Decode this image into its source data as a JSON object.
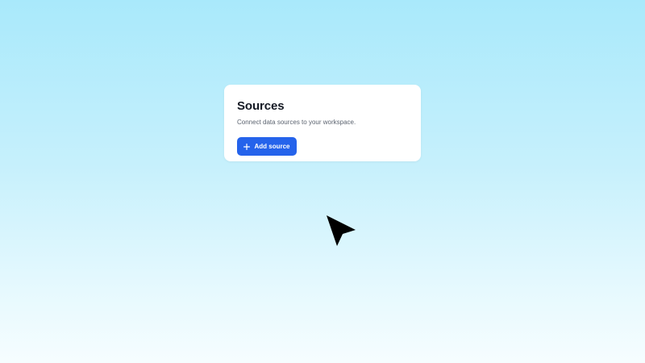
{
  "card": {
    "title": "Sources",
    "subtitle": "Connect data sources to your workspace.",
    "add_button": {
      "label": "Add source",
      "icon": "plus-icon"
    }
  },
  "cursor": {
    "icon": "arrow-cursor-icon"
  },
  "colors": {
    "accent": "#2563eb",
    "card_background": "#ffffff",
    "background_top": "#a9e9fb",
    "background_bottom": "#f6fdff"
  }
}
